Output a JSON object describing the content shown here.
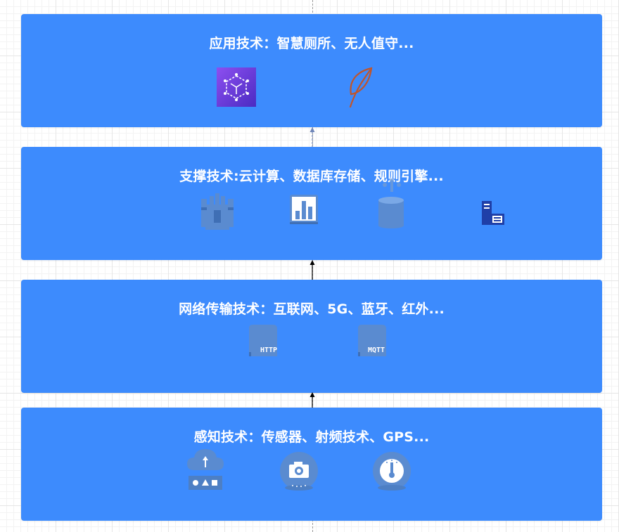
{
  "layers": {
    "application": {
      "title": "应用技术：智慧厕所、无人值守..."
    },
    "support": {
      "title": "支撑技术:云计算、数据库存储、规则引擎..."
    },
    "network": {
      "title": "网络传输技术：互联网、5G、蓝牙、红外...",
      "icon_labels": {
        "http": "HTTP",
        "mqtt": "MQTT"
      }
    },
    "perception": {
      "title": "感知技术：传感器、射频技术、GPS..."
    }
  },
  "icons": {
    "application": [
      "iot-cube-icon",
      "leaf-icon"
    ],
    "support": [
      "cloud-storage-castle-icon",
      "bar-chart-icon",
      "database-icon",
      "server-icon"
    ],
    "network": [
      "http-document-icon",
      "mqtt-document-icon"
    ],
    "perception": [
      "cloud-upload-icon",
      "camera-icon",
      "thermometer-icon"
    ]
  },
  "colors": {
    "layer_fill": "#3d8bfd",
    "title_text": "#ffffff",
    "icon_fill": "#5a8bd0",
    "icon_purple": "#6b3ed6",
    "leaf_stroke": "#c0552b",
    "server_navy": "#1f3fa8"
  }
}
